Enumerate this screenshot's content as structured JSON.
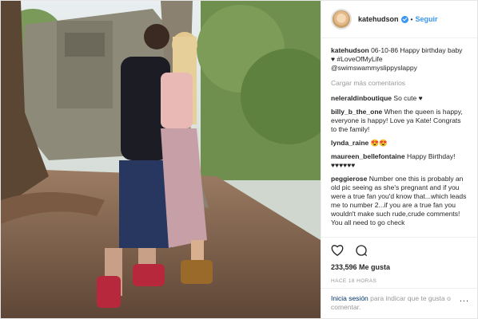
{
  "post": {
    "username": "katehudson",
    "follow_label": "Seguir",
    "caption": {
      "user": "katehudson",
      "text": "06-10-86 Happy birthday baby ♥ #LoveOfMyLife @swimswammyslippyslappy"
    },
    "load_more": "Cargar más comentarios",
    "comments": [
      {
        "user": "neleraldinboutique",
        "text": "So cute ♥"
      },
      {
        "user": "billy_b_the_one",
        "text": "When the queen is happy, everyone is happy! Love ya Kate! Congrats to the family!"
      },
      {
        "user": "lynda_raine",
        "text": "😍😍"
      },
      {
        "user": "maureen_bellefontaine",
        "text": "Happy Birthday!♥♥♥♥♥♥"
      },
      {
        "user": "peggierose",
        "text": "Number one this is probably an old pic seeing as she's pregnant and if you were a true fan you'd know that...which leads me to number 2...if you are a true fan you wouldn't make such rude,crude comments! You all need to go check"
      }
    ],
    "likes": "233,596 Me gusta",
    "time": "HACE 18 HORAS",
    "add_comment": {
      "login_label": "Inicia sesión",
      "rest": " para indicar que te gusta o comentar.",
      "more": "..."
    },
    "icons": {
      "like": "heart-icon",
      "comment": "comment-icon"
    },
    "colors": {
      "link": "#3897f0",
      "tag": "#003569",
      "muted": "#999999"
    }
  }
}
